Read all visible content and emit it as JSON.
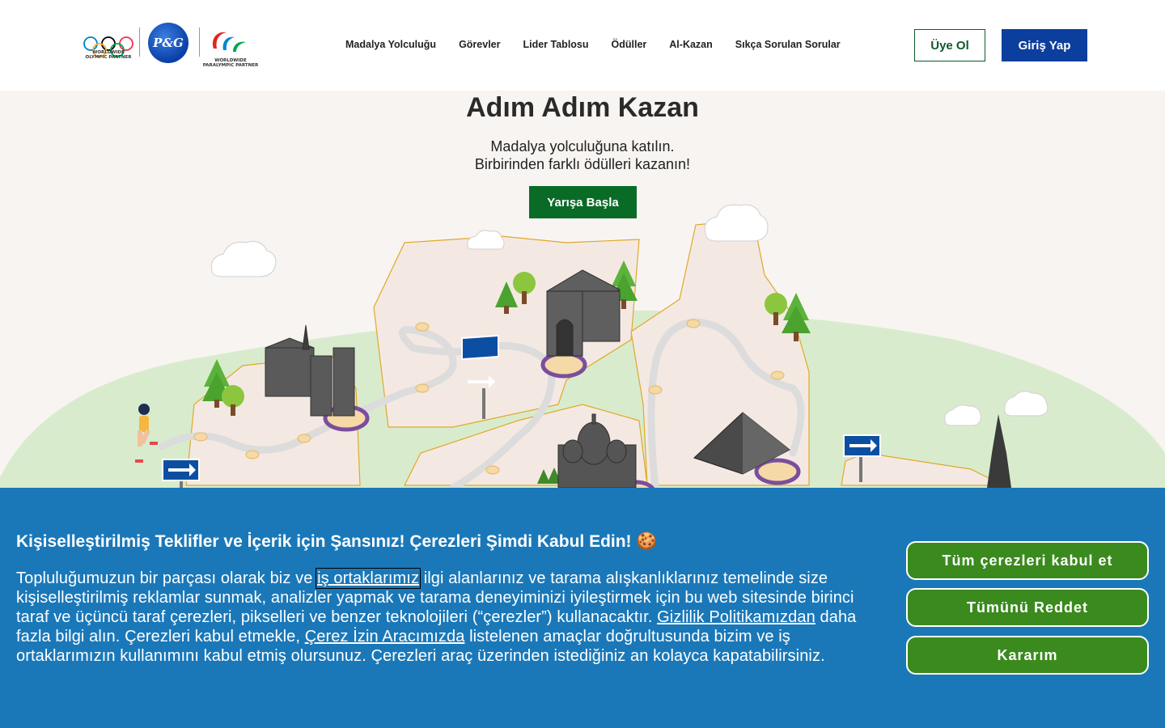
{
  "header": {
    "olympic_caption": "WORLDWIDE OLYMPIC PARTNER",
    "pg_logo": "P&G",
    "paralympic_caption": "WORLDWIDE PARALYMPIC PARTNER",
    "nav": [
      {
        "label": "Madalya Yolculuğu"
      },
      {
        "label": "Görevler"
      },
      {
        "label": "Lider Tablosu"
      },
      {
        "label": "Ödüller"
      },
      {
        "label": "Al-Kazan"
      },
      {
        "label": "Sıkça Sorulan Sorular"
      }
    ],
    "register_label": "Üye Ol",
    "login_label": "Giriş Yap"
  },
  "hero": {
    "title": "Adım Adım Kazan",
    "subtitle_line1": "Madalya yolculuğuna katılın.",
    "subtitle_line2": "Birbirinden farklı ödülleri kazanın!",
    "cta_label": "Yarışa Başla"
  },
  "cookie": {
    "title": "Kişiselleştirilmiş Teklifler ve İçerik için Şansınız! Çerezleri Şimdi Kabul Edin! 🍪",
    "body_part1": "Topluluğumuzun bir parçası olarak biz ve ",
    "link_partners": "iş ortaklarımız",
    "body_part2": " ilgi alanlarınız ve tarama alışkanlıklarınız temelinde size kişiselleştirilmiş reklamlar sunmak, analizler yapmak ve tarama deneyiminizi iyileştirmek için bu web sitesinde birinci taraf ve üçüncü taraf çerezleri, pikselleri ve benzer teknolojileri (“çerezler”) kullanacaktır. ",
    "link_privacy": "Gizlilik Politikamızdan",
    "body_part3": " daha fazla bilgi alın. Çerezleri kabul etmekle, ",
    "link_consent_tool": "Çerez İzin Aracımızda",
    "body_part4": " listelenen amaçlar doğrultusunda bizim ve iş ortaklarımızın kullanımını kabul etmiş olursunuz. Çerezleri araç üzerinden istediğiniz an kolayca kapatabilirsiniz.",
    "accept_all_label": "Tüm çerezleri kabul et",
    "reject_all_label": "Tümünü Reddet",
    "decide_label": "Kararım"
  },
  "colors": {
    "brand_green": "#0a6b27",
    "brand_blue": "#0c3e9e",
    "cookie_bg": "#1a78b9",
    "cookie_button": "#3a8a1e"
  }
}
